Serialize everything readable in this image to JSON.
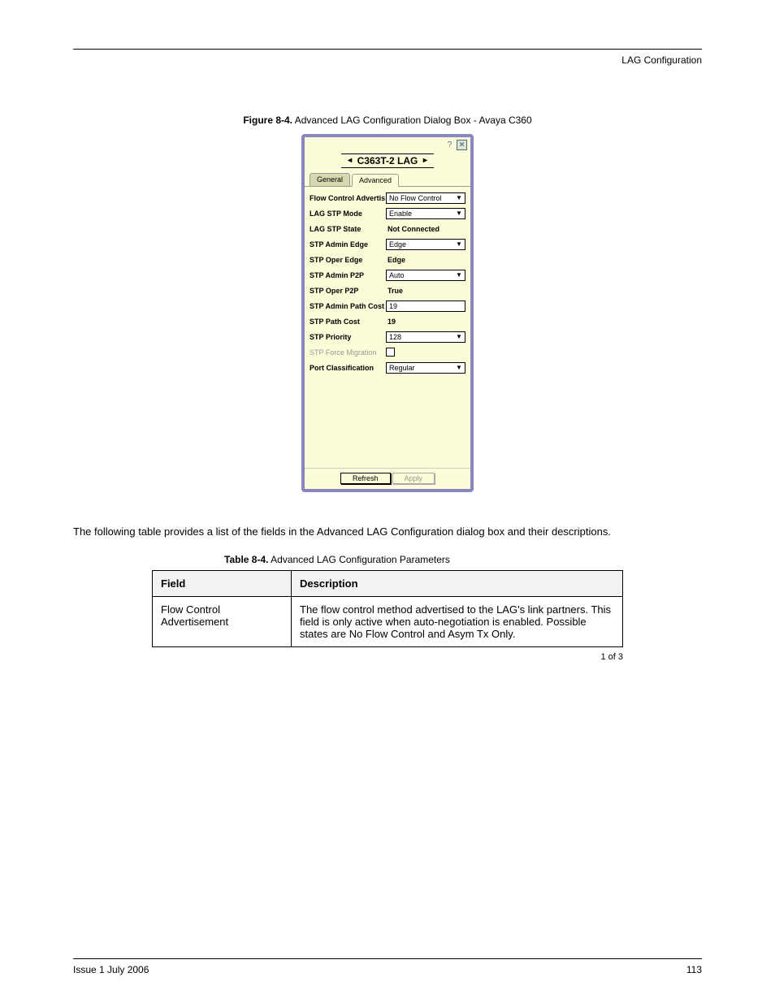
{
  "header": {
    "section_title": "LAG Configuration"
  },
  "figure": {
    "label": "Figure 8-4.",
    "caption": "Advanced LAG Configuration Dialog Box - Avaya C360"
  },
  "dialog": {
    "title": "C363T-2 LAG",
    "tabs": {
      "general": "General",
      "advanced": "Advanced"
    },
    "rows": {
      "flow_ctrl_adv": {
        "label": "Flow Control Advertis",
        "value": "No Flow Control"
      },
      "lag_stp_mode": {
        "label": "LAG STP Mode",
        "value": "Enable"
      },
      "lag_stp_state": {
        "label": "LAG STP State",
        "value": "Not Connected"
      },
      "stp_admin_edge": {
        "label": "STP Admin Edge",
        "value": "Edge"
      },
      "stp_oper_edge": {
        "label": "STP Oper Edge",
        "value": "Edge"
      },
      "stp_admin_p2p": {
        "label": "STP Admin P2P",
        "value": "Auto"
      },
      "stp_oper_p2p": {
        "label": "STP Oper P2P",
        "value": "True"
      },
      "stp_admin_path_cost": {
        "label": "STP Admin Path Cost",
        "value": "19"
      },
      "stp_path_cost": {
        "label": "STP Path Cost",
        "value": "19"
      },
      "stp_priority": {
        "label": "STP Priority",
        "value": "128"
      },
      "stp_force_migration": {
        "label": "STP Force Migration"
      },
      "port_classification": {
        "label": "Port Classification",
        "value": "Regular"
      }
    },
    "buttons": {
      "refresh": "Refresh",
      "apply": "Apply"
    }
  },
  "paragraph": "The following table provides a list of the fields in the Advanced LAG Configuration dialog box and their descriptions.",
  "table": {
    "label": "Table 8-4.",
    "caption": "Advanced LAG Configuration Parameters",
    "headers": {
      "field": "Field",
      "description": "Description"
    },
    "rows": [
      {
        "field": "Flow Control Advertisement",
        "description": "The flow control method advertised to the LAG's link partners. This field is only active when auto-negotiation is enabled. Possible states are No Flow Control and Asym Tx Only."
      }
    ],
    "sheet_note": "1 of 3"
  },
  "footer": {
    "left": "Issue 1 July 2006",
    "right": "113"
  }
}
